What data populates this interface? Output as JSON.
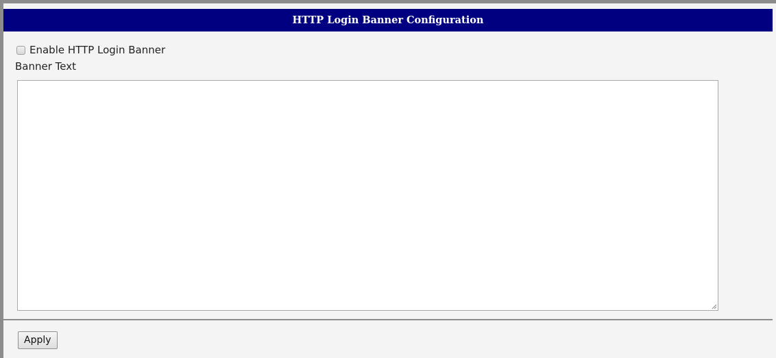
{
  "section": {
    "title": "HTTP Login Banner Configuration"
  },
  "form": {
    "enable_label": "Enable HTTP Login Banner",
    "enable_checked": false,
    "banner_text_label": "Banner Text",
    "banner_text_value": ""
  },
  "actions": {
    "apply_label": "Apply"
  },
  "colors": {
    "header_background": "#000080",
    "header_text": "#ffffff",
    "panel_background": "#f4f4f4",
    "border": "#8c8c8c"
  }
}
